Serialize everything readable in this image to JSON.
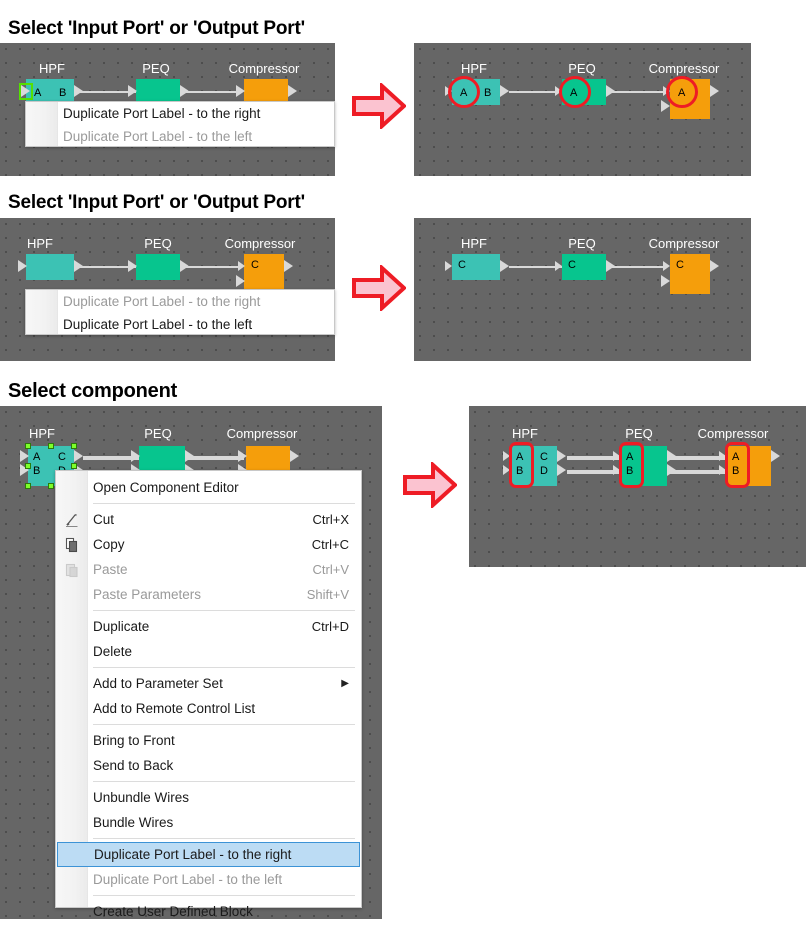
{
  "page": {
    "background": "#ffffff",
    "canvas_bg": "#666666",
    "canvas_dot": "#4d4d4d",
    "accent_red": "#ee1c25",
    "accent_pink": "#fbc3d0",
    "block_colors": {
      "hpf": "#3cc2b4",
      "peq": "#07c58e",
      "compressor": "#f59e0b"
    },
    "selection_handle": "#7dff2a",
    "highlight": "#bcdcf4"
  },
  "sections": [
    {
      "title": "Select 'Input Port' or 'Output Port'",
      "before": {
        "blocks": [
          {
            "name": "HPF",
            "ports_in": [
              "A"
            ],
            "ports_out": [
              "B"
            ]
          },
          {
            "name": "PEQ",
            "ports_in": [],
            "ports_out": []
          },
          {
            "name": "Compressor",
            "ports_in": [],
            "ports_out": []
          }
        ],
        "menu": [
          {
            "label": "Duplicate Port Label - to the right",
            "enabled": true
          },
          {
            "label": "Duplicate Port Label - to the left",
            "enabled": false
          }
        ]
      },
      "after": {
        "blocks": [
          {
            "name": "HPF",
            "ports_in": [
              "A"
            ],
            "ports_out": [
              "B"
            ],
            "marked": "A"
          },
          {
            "name": "PEQ",
            "ports_in": [
              "A"
            ],
            "ports_out": [],
            "marked": "A"
          },
          {
            "name": "Compressor",
            "ports_in": [
              "A"
            ],
            "ports_out": [],
            "marked": "A"
          }
        ]
      }
    },
    {
      "title": "Select 'Input Port' or 'Output Port'",
      "before": {
        "blocks": [
          {
            "name": "HPF",
            "ports_in": [],
            "ports_out": []
          },
          {
            "name": "PEQ",
            "ports_in": [],
            "ports_out": []
          },
          {
            "name": "Compressor",
            "ports_in": [
              "C"
            ],
            "ports_out": []
          }
        ],
        "menu": [
          {
            "label": "Duplicate Port Label - to the right",
            "enabled": false
          },
          {
            "label": "Duplicate Port Label - to the left",
            "enabled": true
          }
        ]
      },
      "after": {
        "blocks": [
          {
            "name": "HPF",
            "ports_in": [
              "C"
            ],
            "ports_out": []
          },
          {
            "name": "PEQ",
            "ports_in": [
              "C"
            ],
            "ports_out": []
          },
          {
            "name": "Compressor",
            "ports_in": [
              "C"
            ],
            "ports_out": []
          }
        ]
      }
    },
    {
      "title": "Select component",
      "before": {
        "blocks": [
          {
            "name": "HPF",
            "ports_in": [
              "A",
              "B"
            ],
            "ports_out": [
              "C",
              "D"
            ],
            "selected": true
          },
          {
            "name": "PEQ",
            "ports_in": [],
            "ports_out": []
          },
          {
            "name": "Compressor",
            "ports_in": [],
            "ports_out": []
          }
        ]
      },
      "after": {
        "blocks": [
          {
            "name": "HPF",
            "ports_in": [
              "A",
              "B"
            ],
            "ports_out": [
              "C",
              "D"
            ],
            "marked": "A,B"
          },
          {
            "name": "PEQ",
            "ports_in": [
              "A",
              "B"
            ],
            "ports_out": [],
            "marked": "A,B"
          },
          {
            "name": "Compressor",
            "ports_in": [
              "A",
              "B"
            ],
            "ports_out": [],
            "marked": "A,B"
          }
        ]
      }
    }
  ],
  "context_menu": {
    "items": [
      {
        "label": "Open Component Editor",
        "accel": "",
        "enabled": true,
        "icon": "",
        "selected": false,
        "submenu": false
      },
      {
        "sep": true
      },
      {
        "label": "Cut",
        "accel": "Ctrl+X",
        "enabled": true,
        "icon": "cut-icon",
        "selected": false,
        "submenu": false
      },
      {
        "label": "Copy",
        "accel": "Ctrl+C",
        "enabled": true,
        "icon": "copy-icon",
        "selected": false,
        "submenu": false
      },
      {
        "label": "Paste",
        "accel": "Ctrl+V",
        "enabled": false,
        "icon": "paste-icon",
        "selected": false,
        "submenu": false
      },
      {
        "label": "Paste Parameters",
        "accel": "Shift+V",
        "enabled": false,
        "icon": "",
        "selected": false,
        "submenu": false
      },
      {
        "sep": true
      },
      {
        "label": "Duplicate",
        "accel": "Ctrl+D",
        "enabled": true,
        "icon": "",
        "selected": false,
        "submenu": false
      },
      {
        "label": "Delete",
        "accel": "",
        "enabled": true,
        "icon": "",
        "selected": false,
        "submenu": false
      },
      {
        "sep": true
      },
      {
        "label": "Add to Parameter Set",
        "accel": "",
        "enabled": true,
        "icon": "",
        "selected": false,
        "submenu": true
      },
      {
        "label": "Add to Remote Control List",
        "accel": "",
        "enabled": true,
        "icon": "",
        "selected": false,
        "submenu": false
      },
      {
        "sep": true
      },
      {
        "label": "Bring to Front",
        "accel": "",
        "enabled": true,
        "icon": "",
        "selected": false,
        "submenu": false
      },
      {
        "label": "Send to Back",
        "accel": "",
        "enabled": true,
        "icon": "",
        "selected": false,
        "submenu": false
      },
      {
        "sep": true
      },
      {
        "label": "Unbundle Wires",
        "accel": "",
        "enabled": true,
        "icon": "",
        "selected": false,
        "submenu": false
      },
      {
        "label": "Bundle Wires",
        "accel": "",
        "enabled": true,
        "icon": "",
        "selected": false,
        "submenu": false
      },
      {
        "sep": true
      },
      {
        "label": "Duplicate Port Label - to the right",
        "accel": "",
        "enabled": true,
        "icon": "",
        "selected": true,
        "submenu": false
      },
      {
        "label": "Duplicate Port Label - to the left",
        "accel": "",
        "enabled": false,
        "icon": "",
        "selected": false,
        "submenu": false
      },
      {
        "sep": true
      },
      {
        "label": "Create User Defined Block",
        "accel": "",
        "enabled": true,
        "icon": "",
        "selected": false,
        "submenu": false
      }
    ],
    "submenu_arrow_glyph": "▶"
  }
}
